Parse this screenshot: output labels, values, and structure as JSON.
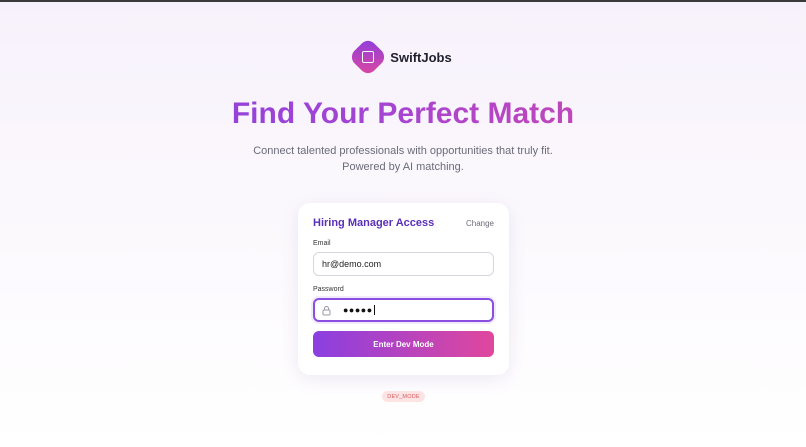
{
  "brand": {
    "name": "SwiftJobs",
    "logo_icon": "square-in-diamond-icon"
  },
  "hero": {
    "title": "Find Your Perfect Match",
    "subtitle_line1": "Connect talented professionals with opportunities that truly fit.",
    "subtitle_line2": "Powered by AI matching."
  },
  "login_card": {
    "title": "Hiring Manager Access",
    "change_label": "Change",
    "email_label": "Email",
    "email_value": "hr@demo.com",
    "password_label": "Password",
    "password_value_masked": "●●●●●",
    "password_icon": "lock-icon",
    "submit_label": "Enter Dev Mode"
  },
  "badge": {
    "label": "DEV_MODE"
  },
  "colors": {
    "accent_purple": "#8b3fe0",
    "accent_pink": "#e0479d",
    "title_purple": "#5b2fb8",
    "badge_bg": "#fde4e4",
    "badge_text": "#d85a5a"
  }
}
